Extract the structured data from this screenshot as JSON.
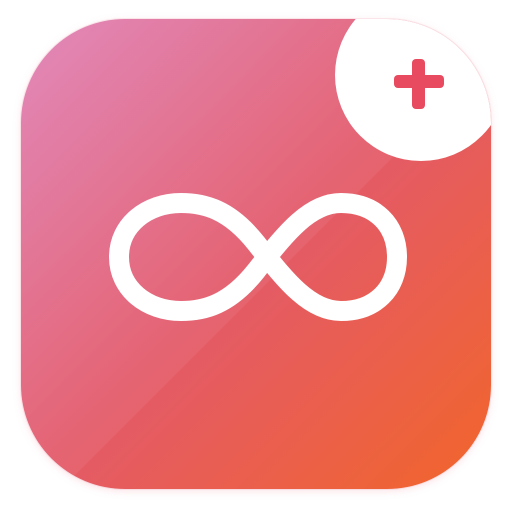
{
  "app_icon": {
    "name": "infinity-app-icon",
    "symbol": "infinity-icon",
    "badge": "plus-icon",
    "colors": {
      "gradient_start": "#DE7CB4",
      "gradient_mid": "#E35A6A",
      "gradient_end": "#F2652A",
      "symbol": "#FFFFFF",
      "badge_background": "#FFFFFF",
      "badge_plus": "#E84A5F"
    }
  }
}
